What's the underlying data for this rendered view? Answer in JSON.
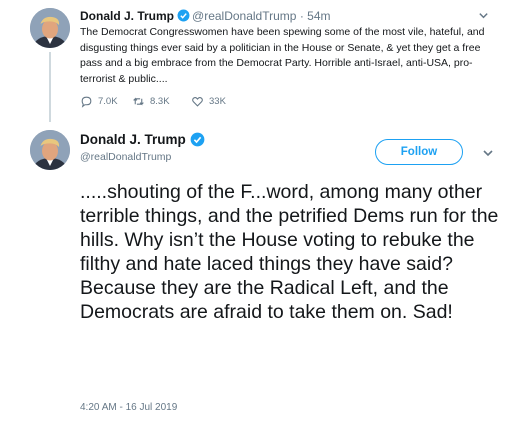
{
  "tweet1": {
    "name": "Donald J. Trump",
    "handle": "@realDonaldTrump",
    "separator": "·",
    "age": "54m",
    "text": "The Democrat Congresswomen have been spewing some of the most vile, hateful, and disgusting things ever said by a politician in the House or Senate, & yet they get a free pass and a big embrace from the Democrat Party. Horrible anti-Israel, anti-USA, pro-terrorist & public....",
    "replies": "7.0K",
    "retweets": "8.3K",
    "likes": "33K",
    "icons": [
      "verified-badge-icon",
      "reply-icon",
      "retweet-icon",
      "like-icon",
      "chevron-down-icon"
    ]
  },
  "tweet2": {
    "name": "Donald J. Trump",
    "handle": "@realDonaldTrump",
    "follow_label": "Follow",
    "text": ".....shouting of the F...word, among many other terrible things, and the petrified Dems run for the hills. Why isn’t the House voting to rebuke the filthy and hate laced things they have said? Because they are the Radical Left, and the Democrats are afraid to take them on. Sad!",
    "timestamp": "4:20 AM - 16 Jul 2019"
  },
  "colors": {
    "accent": "#1da1f2",
    "secondary_text": "#657786",
    "primary_text": "#14171a"
  }
}
